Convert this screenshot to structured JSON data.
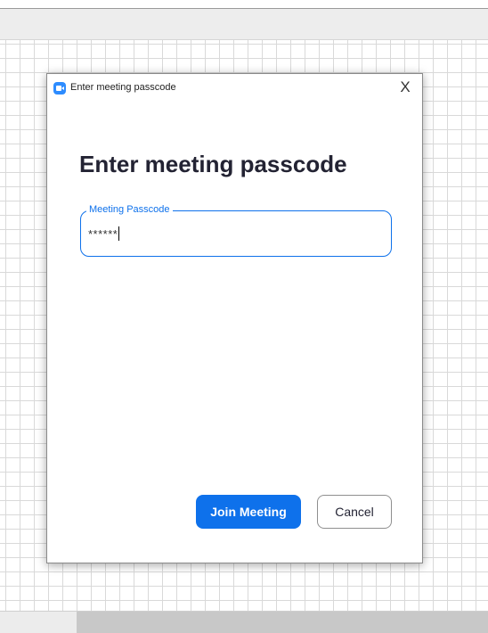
{
  "dialog": {
    "window_title": "Enter meeting passcode",
    "app_icon": "zoom-camera-icon",
    "close_glyph": "X",
    "heading": "Enter meeting passcode",
    "passcode_field": {
      "label": "Meeting Passcode",
      "value": "******"
    },
    "join_label": "Join Meeting",
    "cancel_label": "Cancel"
  },
  "colors": {
    "accent": "#0e71eb",
    "heading": "#232333",
    "grid_line": "#d9d9d9"
  }
}
